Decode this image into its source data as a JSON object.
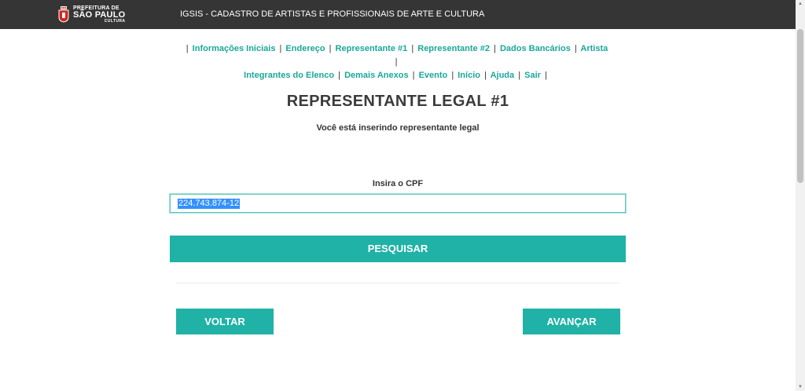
{
  "header": {
    "logo": {
      "line1": "PREFEITURA DE",
      "line2": "SÃO PAULO",
      "line3": "CULTURA"
    },
    "app_title": "IGSIS - CADASTRO DE ARTISTAS E PROFISSIONAIS DE ARTE E CULTURA",
    "background": "#353535"
  },
  "nav": {
    "items": [
      "Informações Iniciais",
      "Endereço",
      "Representante #1",
      "Representante #2",
      "Dados Bancários",
      "Artista",
      "Integrantes do Elenco",
      "Demais Anexos",
      "Evento",
      "Início",
      "Ajuda",
      "Sair"
    ],
    "separator": "|",
    "link_color": "#1aa79a"
  },
  "main": {
    "title": "REPRESENTANTE LEGAL #1",
    "subtitle": "Você está inserindo representante legal",
    "cpf_label": "Insira o CPF",
    "cpf_value": "224.743.874-12",
    "search_button": "PESQUISAR",
    "back_button": "VOLTAR",
    "next_button": "AVANÇAR",
    "accent": "#20b2a6"
  }
}
